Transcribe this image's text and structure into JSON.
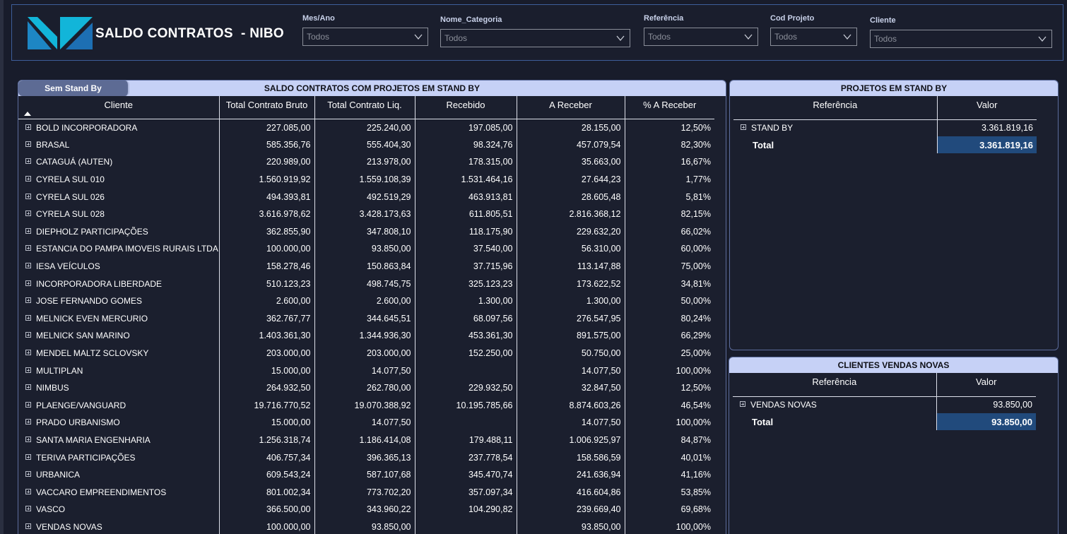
{
  "header": {
    "title": "SALDO CONTRATOS  - NIBO",
    "filters": [
      {
        "label": "Mes/Ano",
        "value": "Todos"
      },
      {
        "label": "Nome_Categoria",
        "value": "Todos"
      },
      {
        "label": "Referência",
        "value": "Todos"
      },
      {
        "label": "Cod Projeto",
        "value": "Todos"
      },
      {
        "label": "Cliente",
        "value": "Todos"
      }
    ]
  },
  "main": {
    "toggle_label": "Sem Stand By",
    "title": "SALDO CONTRATOS COM PROJETOS EM STAND BY",
    "columns": [
      "Cliente",
      "Total Contrato Bruto",
      "Total Contrato Liq.",
      "Recebido",
      "A Receber",
      "% A Receber"
    ],
    "rows": [
      [
        "BOLD INCORPORADORA",
        "227.085,00",
        "225.240,00",
        "197.085,00",
        "28.155,00",
        "12,50%"
      ],
      [
        "BRASAL",
        "585.356,76",
        "555.404,30",
        "98.324,76",
        "457.079,54",
        "82,30%"
      ],
      [
        "CATAGUÁ (AUTEN)",
        "220.989,00",
        "213.978,00",
        "178.315,00",
        "35.663,00",
        "16,67%"
      ],
      [
        "CYRELA SUL 010",
        "1.560.919,92",
        "1.559.108,39",
        "1.531.464,16",
        "27.644,23",
        "1,77%"
      ],
      [
        "CYRELA SUL 026",
        "494.393,81",
        "492.519,29",
        "463.913,81",
        "28.605,48",
        "5,81%"
      ],
      [
        "CYRELA SUL 028",
        "3.616.978,62",
        "3.428.173,63",
        "611.805,51",
        "2.816.368,12",
        "82,15%"
      ],
      [
        "DIEPHOLZ PARTICIPAÇÕES",
        "362.855,90",
        "347.808,10",
        "118.175,90",
        "229.632,20",
        "66,02%"
      ],
      [
        "ESTANCIA DO PAMPA IMOVEIS RURAIS LTDA",
        "100.000,00",
        "93.850,00",
        "37.540,00",
        "56.310,00",
        "60,00%"
      ],
      [
        "IESA VEÍCULOS",
        "158.278,46",
        "150.863,84",
        "37.715,96",
        "113.147,88",
        "75,00%"
      ],
      [
        "INCORPORADORA LIBERDADE",
        "510.123,23",
        "498.745,75",
        "325.123,23",
        "173.622,52",
        "34,81%"
      ],
      [
        "JOSE FERNANDO GOMES",
        "2.600,00",
        "2.600,00",
        "1.300,00",
        "1.300,00",
        "50,00%"
      ],
      [
        "MELNICK EVEN MERCURIO",
        "362.767,77",
        "344.645,51",
        "68.097,56",
        "276.547,95",
        "80,24%"
      ],
      [
        "MELNICK SAN MARINO",
        "1.403.361,30",
        "1.344.936,30",
        "453.361,30",
        "891.575,00",
        "66,29%"
      ],
      [
        "MENDEL MALTZ SCLOVSKY",
        "203.000,00",
        "203.000,00",
        "152.250,00",
        "50.750,00",
        "25,00%"
      ],
      [
        "MULTIPLAN",
        "15.000,00",
        "14.077,50",
        "",
        "14.077,50",
        "100,00%"
      ],
      [
        "NIMBUS",
        "264.932,50",
        "262.780,00",
        "229.932,50",
        "32.847,50",
        "12,50%"
      ],
      [
        "PLAENGE/VANGUARD",
        "19.716.770,52",
        "19.070.388,92",
        "10.195.785,66",
        "8.874.603,26",
        "46,54%"
      ],
      [
        "PRADO URBANISMO",
        "15.000,00",
        "14.077,50",
        "",
        "14.077,50",
        "100,00%"
      ],
      [
        "SANTA MARIA ENGENHARIA",
        "1.256.318,74",
        "1.186.414,08",
        "179.488,11",
        "1.006.925,97",
        "84,87%"
      ],
      [
        "TERIVA PARTICIPAÇÕES",
        "406.757,34",
        "396.365,13",
        "237.778,54",
        "158.586,59",
        "40,01%"
      ],
      [
        "URBANICA",
        "609.543,24",
        "587.107,68",
        "345.470,74",
        "241.636,94",
        "41,16%"
      ],
      [
        "VACCARO EMPREENDIMENTOS",
        "801.002,34",
        "773.702,20",
        "357.097,34",
        "416.604,86",
        "53,85%"
      ],
      [
        "VASCO",
        "366.500,00",
        "343.960,22",
        "104.290,82",
        "239.669,40",
        "69,68%"
      ],
      [
        "VENDAS NOVAS",
        "100.000,00",
        "93.850,00",
        "",
        "93.850,00",
        "100,00%"
      ]
    ]
  },
  "standby": {
    "title": "PROJETOS EM STAND BY",
    "columns": [
      "Referência",
      "Valor"
    ],
    "row_label": "STAND BY",
    "row_value": "3.361.819,16",
    "total_label": "Total",
    "total_value": "3.361.819,16"
  },
  "vendas": {
    "title": "CLIENTES VENDAS NOVAS",
    "columns": [
      "Referência",
      "Valor"
    ],
    "row_label": "VENDAS NOVAS",
    "row_value": "93.850,00",
    "total_label": "Total",
    "total_value": "93.850,00"
  },
  "colors": {
    "background": "#181c2b",
    "panel_header": "#c6d1f6",
    "total_highlight": "#214a7c",
    "logo_cyan": "#12b5d9",
    "logo_blue": "#1d6fb3"
  }
}
